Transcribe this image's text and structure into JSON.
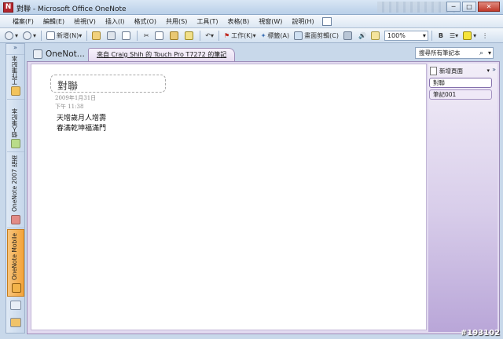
{
  "window": {
    "title": "對聯 - Microsoft Office OneNote",
    "app_icon": "N",
    "controls": [
      "─",
      "□",
      "✕"
    ]
  },
  "menu": {
    "items": [
      "檔案(F)",
      "編輯(E)",
      "檢視(V)",
      "插入(I)",
      "格式(O)",
      "共用(S)",
      "工具(T)",
      "表格(B)",
      "視窗(W)",
      "說明(H)"
    ]
  },
  "toolbar": {
    "new_label": "新增(N)",
    "task_label": "工作(K)",
    "tags_label": "標籤(A)",
    "clipping_label": "畫面剪輯(C)",
    "zoom_value": "100%",
    "bold_label": "B"
  },
  "nav": {
    "collapse_glyph": "»",
    "notebooks": [
      {
        "label": "工作筆記本",
        "color": "#f2c35c"
      },
      {
        "label": "個人筆記本",
        "color": "#b9dc8a"
      },
      {
        "label": "OneNote 2007 指南",
        "color": "#e28b86"
      },
      {
        "label": "OneNote Mobile",
        "color": "#f3b34a"
      }
    ]
  },
  "tabs": {
    "notebook_label": "OneNot...",
    "section_label": "來自 Craig Shih 的 Touch Pro T7272 的筆記",
    "search_placeholder": "搜尋所有筆記本",
    "search_glyph": "⌕"
  },
  "page": {
    "title": "對聯",
    "date": "2009年1月31日",
    "time": "下午 11:38",
    "lines": [
      "天增歲月人增壽",
      "春滿乾坤福滿門"
    ]
  },
  "pagelist": {
    "new_page_label": "新增頁面",
    "collapse_glyph": "»",
    "pages": [
      {
        "label": "對聯",
        "selected": true
      },
      {
        "label": "筆記001",
        "selected": false
      }
    ]
  },
  "watermark": "#193102"
}
